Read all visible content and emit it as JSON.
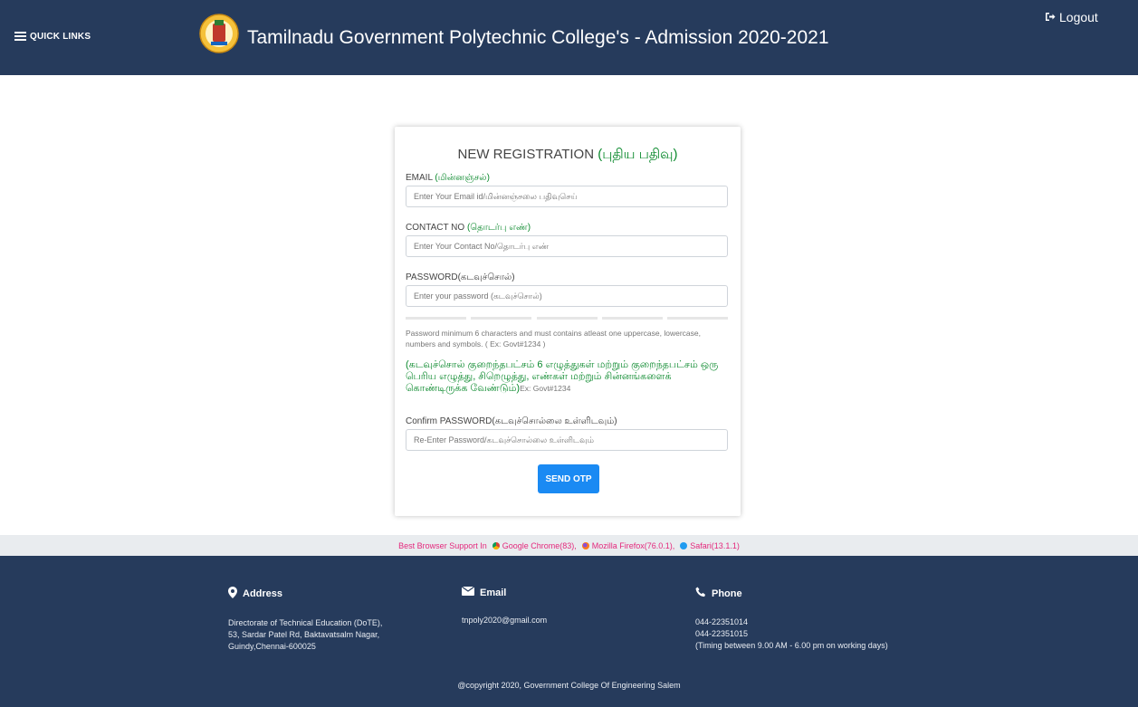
{
  "header": {
    "quick_links": "QUICK LINKS",
    "title": "Tamilnadu Government Polytechnic College's - Admission 2020-2021",
    "logout": "Logout",
    "bg_color": "#263b5c"
  },
  "form": {
    "title": "NEW REGISTRATION",
    "title_ta": "(புதிய பதிவு)",
    "email_label": "EMAIL",
    "email_label_ta": "(மின்னஞ்சல்)",
    "email_placeholder": "Enter Your Email id/மின்னஞ்சலை பதிவுசெய்",
    "contact_label": "CONTACT NO",
    "contact_label_ta": "(தொடர்பு எண்)",
    "contact_placeholder": "Enter Your Contact No/தொடர்பு எண்",
    "password_label": "PASSWORD(கடவுச்சொல்)",
    "password_placeholder": "Enter your password  (கடவுச்சொல்)",
    "password_hint": "Password minimum 6 characters and must contains atleast one uppercase, lowercase, numbers and symbols. ( Ex: Govt#1234 )",
    "password_hint_ta": "(கடவுச்சொல் குறைந்தபட்சம் 6 எழுத்துகள் மற்றும் குறைந்தபட்சம் ஒரு பெரிய எழுத்து, சிறெழுத்து, எண்கள் மற்றும் சின்னங்களைக் கொண்டிருக்க வேண்டும்)",
    "password_hint_ta_example": "Ex: Govt#1234",
    "confirm_label": "Confirm PASSWORD(கடவுச்சொல்லை உள்ளிடவும்)",
    "confirm_placeholder": "Re-Enter Password/கடவுச்சொல்லை உள்ளிடவும்",
    "send_otp": "SEND OTP",
    "button_color": "#1a8af3",
    "tamil_color": "#0c8a2e"
  },
  "browser_support": {
    "prefix": "Best Browser Support In",
    "chrome": "Google Chrome(83),",
    "firefox": "Mozilla Firefox(76.0.1),",
    "safari": "Safari(13.1.1)",
    "text_color": "#e4287c"
  },
  "footer": {
    "address_head": "Address",
    "address_lines": [
      "Directorate of Technical Education (DoTE),",
      "53, Sardar Patel Rd, Baktavatsalm Nagar,",
      "Guindy,Chennai-600025"
    ],
    "email_head": "Email",
    "email": "tnpoly2020@gmail.com",
    "phone_head": "Phone",
    "phone_lines": [
      "044-22351014",
      "044-22351015",
      "(Timing between 9.00 AM - 6.00 pm on working days)"
    ],
    "copyright": "@copyright 2020, Government College Of Engineering Salem"
  }
}
